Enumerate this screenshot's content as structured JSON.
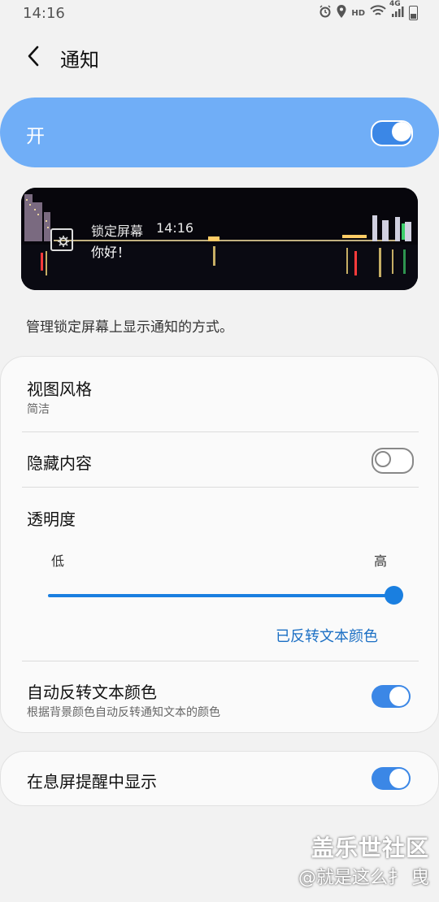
{
  "status_bar": {
    "time": "14:16",
    "icons": [
      "alarm-icon",
      "location-icon",
      "hd-icon",
      "wifi-icon",
      "signal-4g-icon",
      "battery-icon"
    ],
    "hd_label": "HD",
    "network_label": "4G"
  },
  "header": {
    "title": "通知"
  },
  "master_switch": {
    "label": "开",
    "on": true
  },
  "preview": {
    "app_title": "锁定屏幕",
    "time": "14:16",
    "message": "你好！"
  },
  "description": "管理锁定屏幕上显示通知的方式。",
  "settings": {
    "view_style": {
      "title": "视图风格",
      "value": "简洁"
    },
    "hide_content": {
      "title": "隐藏内容",
      "on": false
    },
    "transparency": {
      "title": "透明度",
      "low_label": "低",
      "high_label": "高",
      "level": 1.0
    },
    "inverted_text_link": "已反转文本颜色",
    "auto_invert": {
      "title": "自动反转文本颜色",
      "subtitle": "根据背景颜色自动反转通知文本的颜色",
      "on": true
    }
  },
  "aod": {
    "title": "在息屏提醒中显示",
    "on": true
  },
  "watermark": {
    "line1": "盖乐世社区",
    "line2": "@就是这么扌 曳"
  },
  "colors": {
    "accent": "#3b87e6",
    "master_bg": "#70aef7",
    "link": "#1b6fc4"
  }
}
